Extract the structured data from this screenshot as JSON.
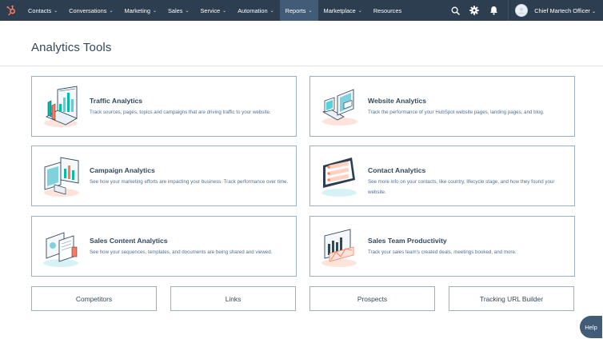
{
  "nav": {
    "items": [
      {
        "label": "Contacts",
        "chev": "⌄"
      },
      {
        "label": "Conversations",
        "chev": "⌄"
      },
      {
        "label": "Marketing",
        "chev": "⌄"
      },
      {
        "label": "Sales",
        "chev": "⌄"
      },
      {
        "label": "Service",
        "chev": "⌄"
      },
      {
        "label": "Automation",
        "chev": "⌄"
      },
      {
        "label": "Reports",
        "chev": "⌄",
        "active": true
      },
      {
        "label": "Marketplace",
        "chev": "⌄"
      },
      {
        "label": "Resources"
      }
    ],
    "user_name": "Chief Martech Officer",
    "user_chev": "⌄",
    "icons": [
      "search-icon",
      "gear-icon",
      "bell-icon"
    ]
  },
  "page": {
    "title": "Analytics Tools"
  },
  "cards": [
    {
      "title": "Traffic Analytics",
      "desc": "Track sources, pages, topics and campaigns that are driving traffic to your website.",
      "icon": "traffic-analytics-illustration"
    },
    {
      "title": "Website Analytics",
      "desc": "Track the performance of your HubSpot website pages, landing pages, and blog.",
      "icon": "website-analytics-illustration"
    },
    {
      "title": "Campaign Analytics",
      "desc": "See how your marketing efforts are impacting your business. Track performance over time.",
      "icon": "campaign-analytics-illustration"
    },
    {
      "title": "Contact Analytics",
      "desc": "See more info on your contacts, like country, lifecycle stage, and how they found your website.",
      "icon": "contact-analytics-illustration"
    },
    {
      "title": "Sales Content Analytics",
      "desc": "See how your sequences, templates, and documents are being shared and viewed.",
      "icon": "sales-content-illustration"
    },
    {
      "title": "Sales Team Productivity",
      "desc": "Track your sales team's created deals, meetings booked, and more.",
      "icon": "sales-team-illustration"
    }
  ],
  "links": [
    "Competitors",
    "Links",
    "Prospects",
    "Tracking URL Builder"
  ],
  "help": {
    "label": "Help"
  },
  "colors": {
    "nav_bg": "#2d3e50",
    "nav_active": "#425b76",
    "text": "#33475b",
    "border": "#99afc4",
    "accent": "#ff7a59",
    "teal": "#00bda5"
  }
}
